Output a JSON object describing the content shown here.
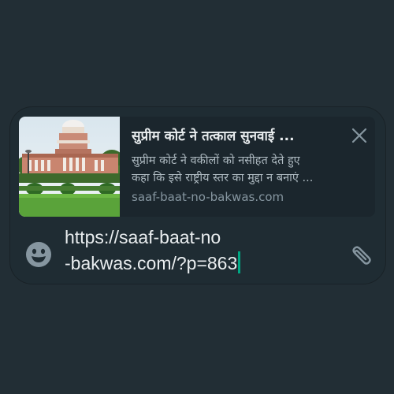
{
  "link_preview": {
    "title": "सुप्रीम कोर्ट ने तत्काल सुनवाई ...",
    "description_line1": "सुप्रीम कोर्ट ने वकीलों को नसीहत देते हुए",
    "description_line2": "कहा कि इसे राष्ट्रीय स्तर का मुद्दा न बनाएं ...",
    "domain": "saaf-baat-no-bakwas.com",
    "thumbnail_icon": "supreme-court-building-image",
    "close_icon": "close-icon"
  },
  "composer": {
    "text_line1": "https://saaf-baat-no",
    "text_line2": "-bakwas.com/?p=863",
    "emoji_icon": "emoji-icon",
    "attach_icon": "paperclip-icon"
  },
  "colors": {
    "background": "#222e35",
    "composer_bg": "#1f2c33",
    "caret": "#00a884",
    "text_primary": "#e9edef",
    "text_secondary": "#aebac1",
    "icon": "#8696a0"
  }
}
